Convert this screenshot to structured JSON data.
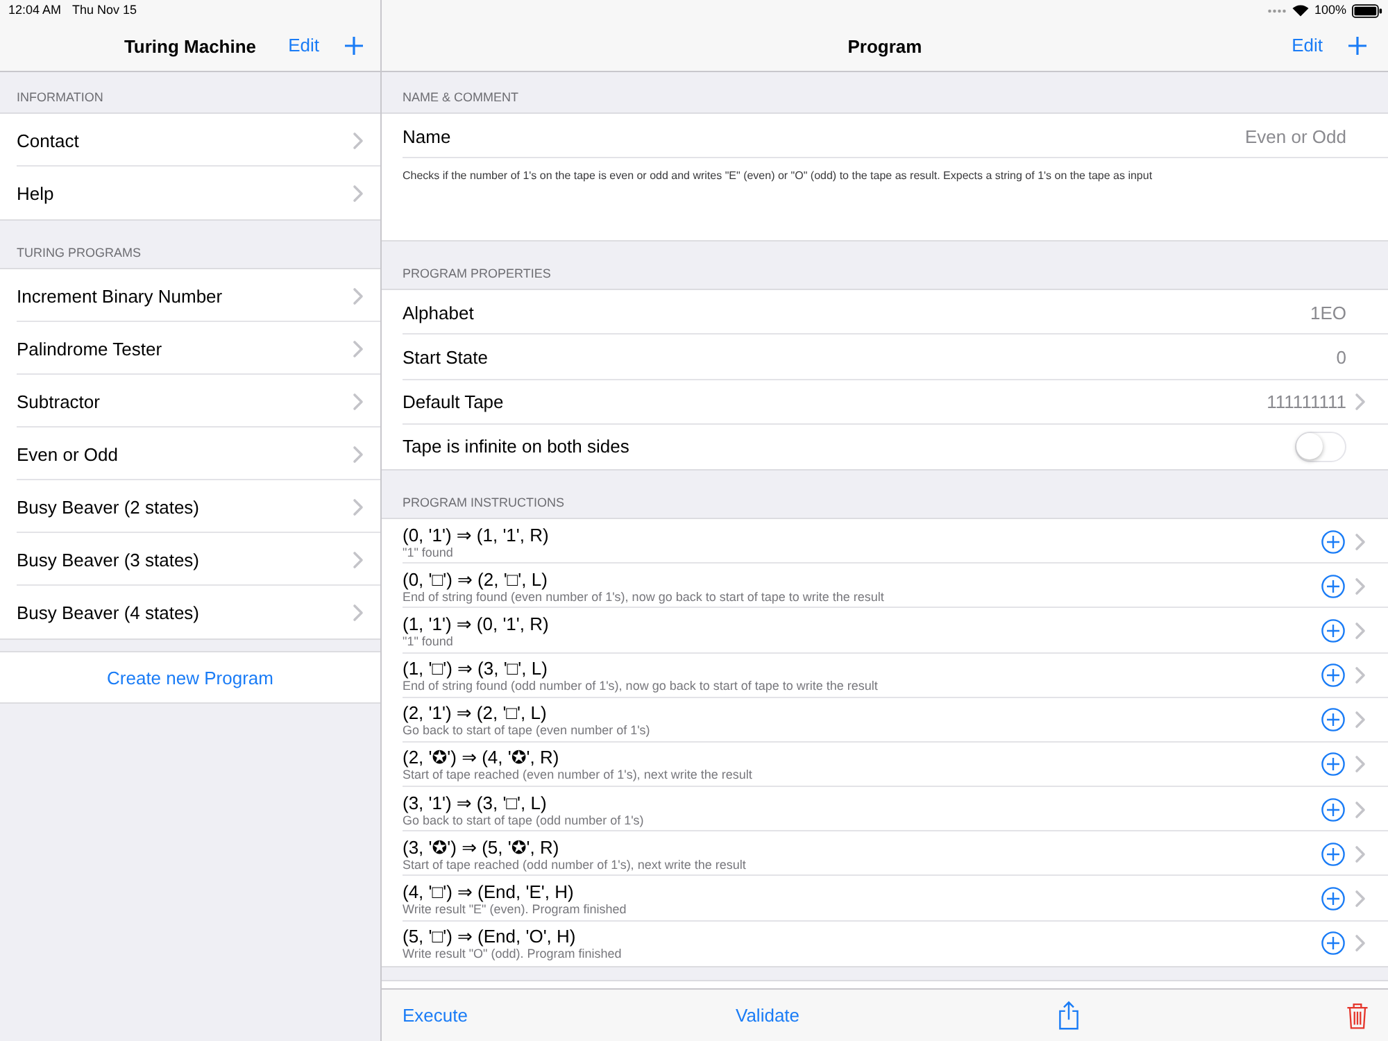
{
  "status_bar": {
    "time": "12:04 AM",
    "date": "Thu Nov 15",
    "battery": "100%"
  },
  "sidebar": {
    "title": "Turing Machine",
    "edit": "Edit",
    "sections": [
      {
        "header": "INFORMATION",
        "items": [
          {
            "label": "Contact"
          },
          {
            "label": "Help"
          }
        ]
      },
      {
        "header": "TURING PROGRAMS",
        "items": [
          {
            "label": "Increment Binary Number"
          },
          {
            "label": "Palindrome Tester"
          },
          {
            "label": "Subtractor"
          },
          {
            "label": "Even or Odd"
          },
          {
            "label": "Busy Beaver (2 states)"
          },
          {
            "label": "Busy Beaver (3 states)"
          },
          {
            "label": "Busy Beaver (4 states)"
          }
        ]
      }
    ],
    "create_button": "Create new Program"
  },
  "detail": {
    "title": "Program",
    "edit": "Edit",
    "sections": [
      {
        "header": "NAME & COMMENT",
        "rows": [
          {
            "kind": "value",
            "label": "Name",
            "value": "Even or Odd"
          },
          {
            "kind": "note",
            "text": "Checks if the number of 1's on the tape is even or odd and writes \"E\" (even) or \"O\" (odd) to the tape as result. Expects a string of 1's on the tape as input"
          }
        ]
      },
      {
        "header": "PROGRAM PROPERTIES",
        "rows": [
          {
            "kind": "value",
            "label": "Alphabet",
            "value": "1EO"
          },
          {
            "kind": "value",
            "label": "Start State",
            "value": "0"
          },
          {
            "kind": "link",
            "label": "Default Tape",
            "value": "111111111"
          },
          {
            "kind": "switch",
            "label": "Tape is infinite on both sides",
            "on": false
          }
        ]
      },
      {
        "header": "PROGRAM INSTRUCTIONS",
        "rows": [
          {
            "kind": "instruction",
            "rule": "(0, '1') ⇒ (1, '1', R)",
            "note": "\"1\" found"
          },
          {
            "kind": "instruction",
            "rule": "(0, '□') ⇒ (2, '□', L)",
            "note": "End of string found (even number of 1's), now go back to start of tape to write the result"
          },
          {
            "kind": "instruction",
            "rule": "(1, '1') ⇒ (0, '1', R)",
            "note": "\"1\" found"
          },
          {
            "kind": "instruction",
            "rule": "(1, '□') ⇒ (3, '□', L)",
            "note": "End of string found (odd number of 1's), now go back to start of tape to write the result"
          },
          {
            "kind": "instruction",
            "rule": "(2, '1') ⇒ (2, '□', L)",
            "note": "Go back to start of tape (even number of 1's)"
          },
          {
            "kind": "instruction",
            "rule": "(2, '✪') ⇒ (4, '✪', R)",
            "note": "Start of tape reached (even number of 1's), next write the result"
          },
          {
            "kind": "instruction",
            "rule": "(3, '1') ⇒ (3, '□', L)",
            "note": "Go back to start of tape (odd number of 1's)"
          },
          {
            "kind": "instruction",
            "rule": "(3, '✪') ⇒ (5, '✪', R)",
            "note": "Start of tape reached (odd number of 1's), next write the result"
          },
          {
            "kind": "instruction",
            "rule": "(4, '□') ⇒ (End, 'E', H)",
            "note": "Write result \"E\" (even). Program finished"
          },
          {
            "kind": "instruction",
            "rule": "(5, '□') ⇒ (End, 'O', H)",
            "note": "Write result \"O\" (odd). Program finished"
          }
        ]
      }
    ]
  },
  "toolbar": {
    "buttons": [
      {
        "kind": "text",
        "label": "Execute"
      },
      {
        "kind": "text",
        "label": "Validate"
      },
      {
        "kind": "share"
      },
      {
        "kind": "trash"
      }
    ]
  }
}
